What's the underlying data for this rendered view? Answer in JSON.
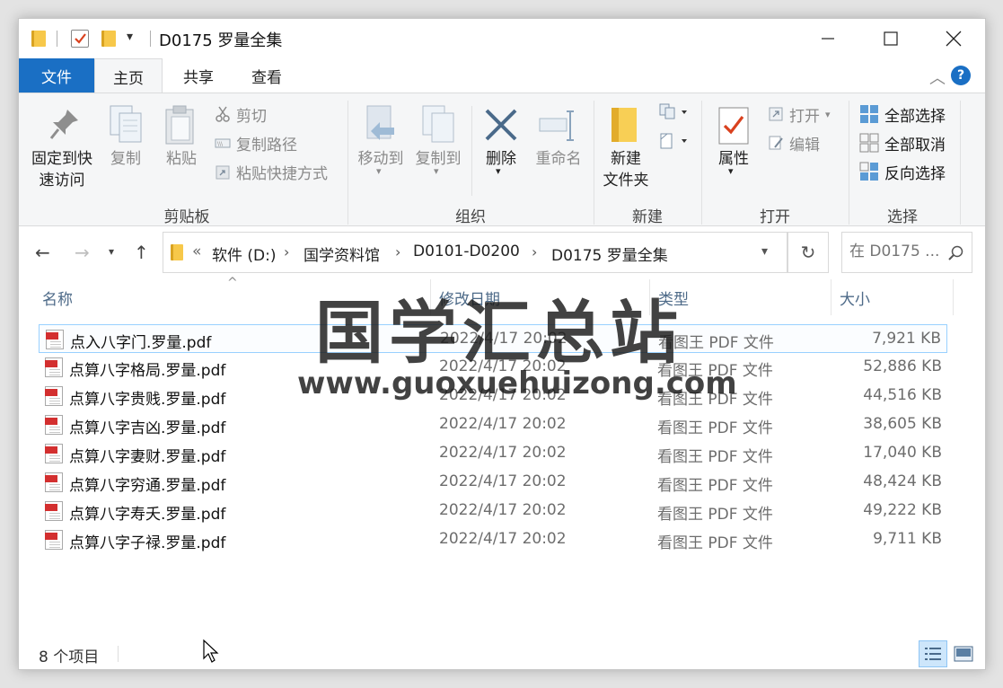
{
  "window": {
    "title": "D0175 罗量全集",
    "accent": "#1a6fc4"
  },
  "tabs": [
    {
      "label": "文件"
    },
    {
      "label": "主页"
    },
    {
      "label": "共享"
    },
    {
      "label": "查看"
    }
  ],
  "ribbon": {
    "clipboard": {
      "pin": "固定到快",
      "pin2": "速访问",
      "copy": "复制",
      "paste": "粘贴",
      "cut": "剪切",
      "copy_path": "复制路径",
      "paste_shortcut": "粘贴快捷方式",
      "group": "剪贴板"
    },
    "organize": {
      "move_to": "移动到",
      "copy_to": "复制到",
      "delete": "删除",
      "rename": "重命名",
      "group": "组织"
    },
    "new": {
      "new_folder": "新建",
      "new_folder2": "文件夹",
      "group": "新建"
    },
    "open": {
      "properties": "属性",
      "open": "打开",
      "edit": "编辑",
      "group": "打开"
    },
    "select": {
      "select_all": "全部选择",
      "select_none": "全部取消",
      "invert": "反向选择",
      "group": "选择"
    }
  },
  "address": {
    "overflow": "«",
    "crumbs": [
      "软件 (D:)",
      "国学资料馆",
      "D0101-D0200",
      "D0175 罗量全集"
    ],
    "search_placeholder": "在 D0175 ..."
  },
  "columns": {
    "name": "名称",
    "date": "修改日期",
    "type": "类型",
    "size": "大小"
  },
  "files": [
    {
      "name": "点入八字门.罗量.pdf",
      "date": "2022/4/17 20:02",
      "type": "看图王 PDF 文件",
      "size": "7,921 KB"
    },
    {
      "name": "点算八字格局.罗量.pdf",
      "date": "2022/4/17 20:02",
      "type": "看图王 PDF 文件",
      "size": "52,886 KB"
    },
    {
      "name": "点算八字贵贱.罗量.pdf",
      "date": "2022/4/17 20:02",
      "type": "看图王 PDF 文件",
      "size": "44,516 KB"
    },
    {
      "name": "点算八字吉凶.罗量.pdf",
      "date": "2022/4/17 20:02",
      "type": "看图王 PDF 文件",
      "size": "38,605 KB"
    },
    {
      "name": "点算八字妻财.罗量.pdf",
      "date": "2022/4/17 20:02",
      "type": "看图王 PDF 文件",
      "size": "17,040 KB"
    },
    {
      "name": "点算八字穷通.罗量.pdf",
      "date": "2022/4/17 20:02",
      "type": "看图王 PDF 文件",
      "size": "48,424 KB"
    },
    {
      "name": "点算八字寿夭.罗量.pdf",
      "date": "2022/4/17 20:02",
      "type": "看图王 PDF 文件",
      "size": "49,222 KB"
    },
    {
      "name": "点算八字子禄.罗量.pdf",
      "date": "2022/4/17 20:02",
      "type": "看图王 PDF 文件",
      "size": "9,711 KB"
    }
  ],
  "watermark": {
    "title": "国学汇总站",
    "url": "www.guoxuehuizong.com"
  },
  "status": {
    "count": "8 个项目"
  }
}
